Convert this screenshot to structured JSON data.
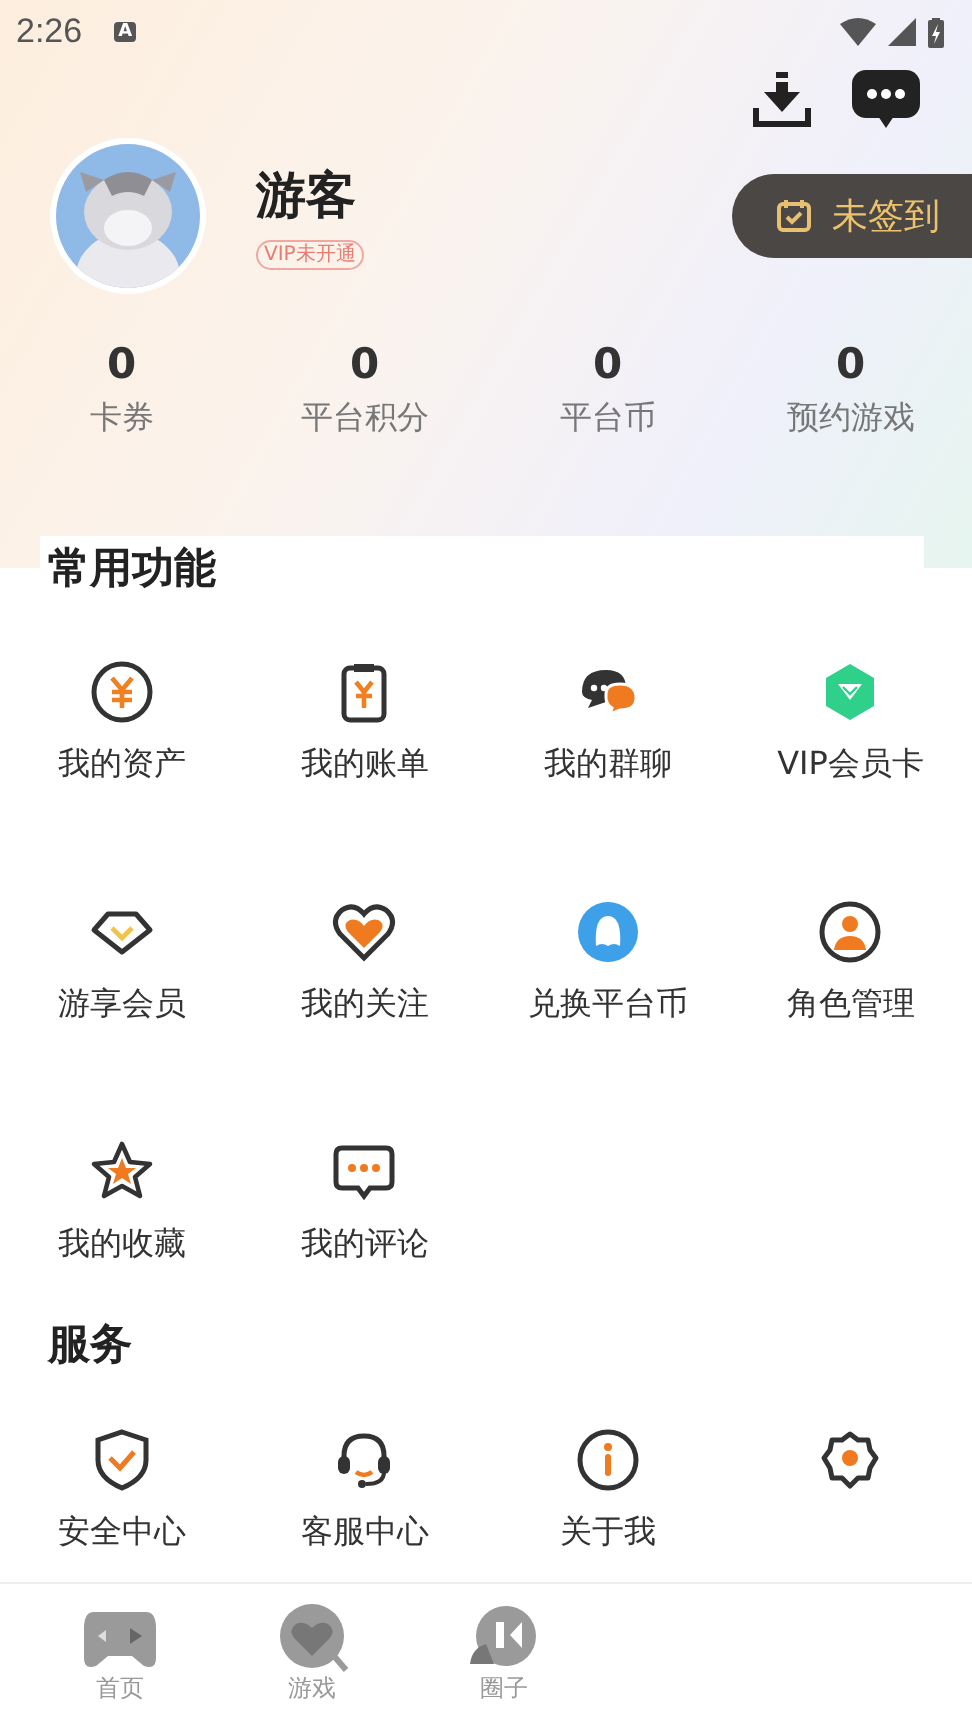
{
  "status_bar": {
    "time": "2:26",
    "badge": "A"
  },
  "profile": {
    "name": "游客",
    "vip_tag": "VIP未开通",
    "checkin": "未签到"
  },
  "stats": [
    {
      "value": "0",
      "label": "卡券"
    },
    {
      "value": "0",
      "label": "平台积分"
    },
    {
      "value": "0",
      "label": "平台币"
    },
    {
      "value": "0",
      "label": "预约游戏"
    }
  ],
  "common": {
    "title": "常用功能",
    "items": [
      {
        "label": "我的资产"
      },
      {
        "label": "我的账单"
      },
      {
        "label": "我的群聊"
      },
      {
        "label": "VIP会员卡"
      },
      {
        "label": "游享会员"
      },
      {
        "label": "我的关注"
      },
      {
        "label": "兑换平台币"
      },
      {
        "label": "角色管理"
      },
      {
        "label": "我的收藏"
      },
      {
        "label": "我的评论"
      }
    ]
  },
  "services": {
    "title": "服务",
    "items": [
      {
        "kind": "labeled",
        "label": "安全中心"
      },
      {
        "kind": "labeled",
        "label": "客服中心"
      },
      {
        "kind": "labeled",
        "label": "关于我"
      },
      {
        "kind": "icon_only"
      }
    ]
  },
  "tab_bar": [
    {
      "label": "首页"
    },
    {
      "label": "游戏"
    },
    {
      "label": "圈子"
    }
  ]
}
